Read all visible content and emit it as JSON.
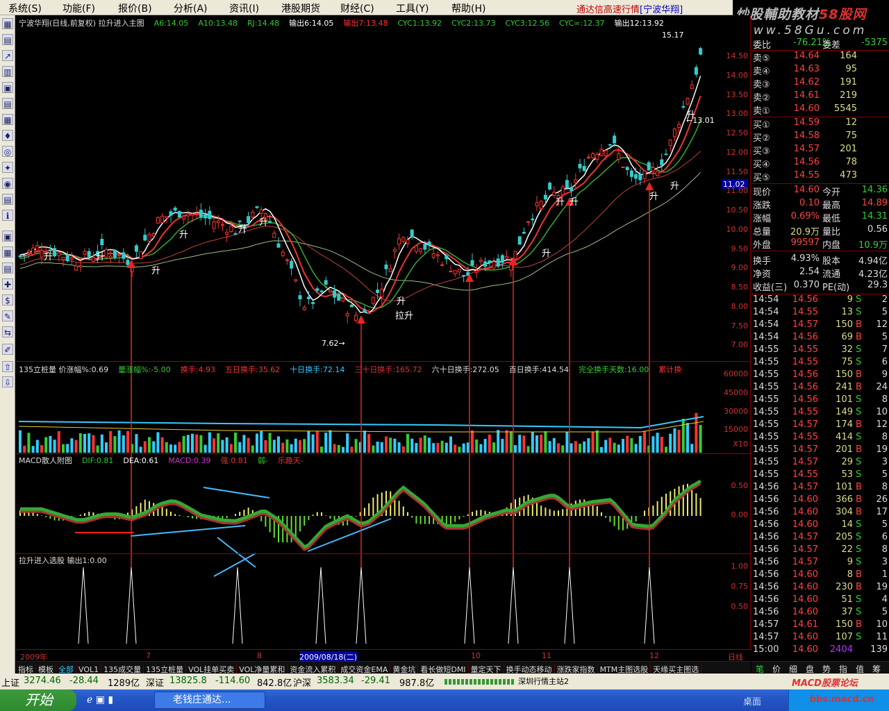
{
  "menu": [
    "系统(S)",
    "功能(F)",
    "报价(B)",
    "分析(A)",
    "资讯(I)",
    "港股期货",
    "财经(C)",
    "工具(Y)",
    "帮助(H)"
  ],
  "app_title": "通达信高速行情",
  "stock_bracket": "[宁波华翔]",
  "watermark": {
    "line1": "炒股輔助教材",
    "line1_red": "58股网",
    "line2": "www.58Gu.com"
  },
  "price_header": [
    {
      "t": "宁波华翔(日线,前复权) 拉升进入主图",
      "c": "#ddd"
    },
    {
      "t": "A6:14.05",
      "c": "#3c3"
    },
    {
      "t": "A10:13.48",
      "c": "#3c3"
    },
    {
      "t": "RJ:14.48",
      "c": "#3c3"
    },
    {
      "t": "输出6:14.05",
      "c": "#fff"
    },
    {
      "t": "输出7:13.48",
      "c": "#f33"
    },
    {
      "t": "CYC1:13.92",
      "c": "#3c3"
    },
    {
      "t": "CYC2:13.73",
      "c": "#3c3"
    },
    {
      "t": "CYC3:12.56",
      "c": "#3c3"
    },
    {
      "t": "CYC∞:12.37",
      "c": "#3c3"
    },
    {
      "t": "输出12:13.92",
      "c": "#fff"
    }
  ],
  "price_axis": [
    "14.50",
    "14.00",
    "13.50",
    "13.00",
    "12.50",
    "12.00",
    "11.50",
    "11.00",
    "10.50",
    "10.00",
    "9.50",
    "9.00",
    "8.50",
    "8.00",
    "7.50",
    "7.00"
  ],
  "price_marks": {
    "high": "15.17",
    "mid": "13.01",
    "low": "7.62",
    "current": "11.02"
  },
  "chart_labels": {
    "rise": "升",
    "lift": "拉升"
  },
  "vol_header": [
    {
      "t": "135立桩量 价涨幅%:0.69",
      "c": "#ddd"
    },
    {
      "t": "量涨幅%:-5.00",
      "c": "#3c3"
    },
    {
      "t": "换手:4.93",
      "c": "#f33"
    },
    {
      "t": "五日换手:35.62",
      "c": "#f33"
    },
    {
      "t": "十日换手:72.14",
      "c": "#3cf"
    },
    {
      "t": "三十日换手:165.72",
      "c": "#d33"
    },
    {
      "t": "六十日换手:272.05",
      "c": "#ddd"
    },
    {
      "t": "百日换手:414.54",
      "c": "#ddd"
    },
    {
      "t": "完全换手天数:16.00",
      "c": "#3c3"
    },
    {
      "t": "累计换",
      "c": "#f33"
    }
  ],
  "vol_axis": [
    "60000",
    "45000",
    "30000",
    "15000",
    "X10"
  ],
  "macd_header": [
    {
      "t": "MACD散人附图",
      "c": "#ddd"
    },
    {
      "t": "DIF:0.81",
      "c": "#3c3"
    },
    {
      "t": "DEA:0.61",
      "c": "#fff"
    },
    {
      "t": "MACD:0.39",
      "c": "#c3c"
    },
    {
      "t": "强:0.81",
      "c": "#d33"
    },
    {
      "t": "弱-",
      "c": "#3c3"
    },
    {
      "t": "乐趣天-",
      "c": "#d33"
    }
  ],
  "macd_axis": [
    "0.50",
    "0.00"
  ],
  "signal_header": "拉升进入选股 输出1:0.00",
  "signal_axis": [
    "1.00",
    "0.75",
    "0.50"
  ],
  "date_axis": [
    "2009年",
    "7",
    "8",
    "2009/08/18(二)",
    "10",
    "11",
    "12",
    "日线"
  ],
  "tabs": [
    "指标",
    "模板",
    "全部",
    "VOL1",
    "135成交量",
    "135立桩量",
    "VOL挂单买卖",
    "VOL净量累和",
    "资金流入累积",
    "成交资金EMA",
    "黄金坑",
    "看长做短DMI",
    "量定天下",
    "换手动态移动",
    "涨跌家指数",
    "MTM主图选股",
    "天缘买主图选"
  ],
  "active_tab": "全部",
  "quote": {
    "wei_bi": {
      "label": "委比",
      "value": "-76.21%",
      "label2": "委差",
      "value2": "-5375"
    },
    "sell": [
      {
        "l": "卖⑤",
        "p": "14.64",
        "v": "164"
      },
      {
        "l": "卖④",
        "p": "14.63",
        "v": "95"
      },
      {
        "l": "卖③",
        "p": "14.62",
        "v": "191"
      },
      {
        "l": "卖②",
        "p": "14.61",
        "v": "219"
      },
      {
        "l": "卖①",
        "p": "14.60",
        "v": "5545"
      }
    ],
    "buy": [
      {
        "l": "买①",
        "p": "14.59",
        "v": "12"
      },
      {
        "l": "买②",
        "p": "14.58",
        "v": "75"
      },
      {
        "l": "买③",
        "p": "14.57",
        "v": "201"
      },
      {
        "l": "买④",
        "p": "14.56",
        "v": "78"
      },
      {
        "l": "买⑤",
        "p": "14.55",
        "v": "473"
      }
    ],
    "stats": [
      {
        "l1": "现价",
        "v1": "14.60",
        "c1": "r",
        "l2": "今开",
        "v2": "14.36",
        "c2": "g"
      },
      {
        "l1": "涨跌",
        "v1": "0.10",
        "c1": "r",
        "l2": "最高",
        "v2": "14.89",
        "c2": "r"
      },
      {
        "l1": "涨幅",
        "v1": "0.69%",
        "c1": "r",
        "l2": "最低",
        "v2": "14.31",
        "c2": "g"
      },
      {
        "l1": "总量",
        "v1": "20.9万",
        "c1": "y",
        "l2": "量比",
        "v2": "0.56",
        "c2": "w"
      },
      {
        "l1": "外盘",
        "v1": "99597",
        "c1": "r",
        "l2": "内盘",
        "v2": "10.9万",
        "c2": "g"
      },
      {
        "l1": "换手",
        "v1": "4.93%",
        "c1": "w",
        "l2": "股本",
        "v2": "4.94亿",
        "c2": "w"
      },
      {
        "l1": "净资",
        "v1": "2.54",
        "c1": "w",
        "l2": "流通",
        "v2": "4.23亿",
        "c2": "w"
      },
      {
        "l1": "收益(三)",
        "v1": "0.370",
        "c1": "w",
        "l2": "PE(动)",
        "v2": "29.3",
        "c2": "w"
      }
    ]
  },
  "ticks": [
    [
      "14:54",
      "14.56",
      "9",
      "S",
      "2"
    ],
    [
      "14:54",
      "14.55",
      "13",
      "S",
      "5"
    ],
    [
      "14:54",
      "14.57",
      "150",
      "B",
      "12"
    ],
    [
      "14:54",
      "14.56",
      "69",
      "B",
      "5"
    ],
    [
      "14:55",
      "14.55",
      "32",
      "S",
      "7"
    ],
    [
      "14:55",
      "14.55",
      "75",
      "S",
      "6"
    ],
    [
      "14:55",
      "14.56",
      "150",
      "B",
      "9"
    ],
    [
      "14:55",
      "14.56",
      "241",
      "B",
      "24"
    ],
    [
      "14:55",
      "14.56",
      "101",
      "S",
      "8"
    ],
    [
      "14:55",
      "14.55",
      "149",
      "S",
      "10"
    ],
    [
      "14:55",
      "14.57",
      "174",
      "B",
      "12"
    ],
    [
      "14:55",
      "14.55",
      "414",
      "S",
      "8"
    ],
    [
      "14:55",
      "14.57",
      "201",
      "B",
      "19"
    ],
    [
      "14:55",
      "14.57",
      "29",
      "S",
      "3"
    ],
    [
      "14:55",
      "14.55",
      "53",
      "S",
      "5"
    ],
    [
      "14:56",
      "14.57",
      "101",
      "B",
      "8"
    ],
    [
      "14:56",
      "14.60",
      "366",
      "B",
      "26"
    ],
    [
      "14:56",
      "14.60",
      "304",
      "B",
      "17"
    ],
    [
      "14:56",
      "14.60",
      "14",
      "S",
      "5"
    ],
    [
      "14:56",
      "14.57",
      "205",
      "S",
      "6"
    ],
    [
      "14:56",
      "14.57",
      "22",
      "S",
      "8"
    ],
    [
      "14:56",
      "14.57",
      "9",
      "S",
      "3"
    ],
    [
      "14:56",
      "14.60",
      "8",
      "B",
      "1"
    ],
    [
      "14:56",
      "14.60",
      "230",
      "B",
      "19"
    ],
    [
      "14:56",
      "14.60",
      "51",
      "S",
      "4"
    ],
    [
      "14:56",
      "14.60",
      "37",
      "S",
      "5"
    ],
    [
      "14:57",
      "14.61",
      "150",
      "B",
      "10"
    ],
    [
      "14:57",
      "14.60",
      "107",
      "S",
      "11"
    ],
    [
      "15:00",
      "14.60",
      "2404",
      "",
      "139"
    ]
  ],
  "right_tabs": [
    "笔",
    "价",
    "细",
    "盘",
    "势",
    "指",
    "值",
    "筹"
  ],
  "status": {
    "sh_label": "上证",
    "sh": "3274.46",
    "sh_chg": "-28.44",
    "sh_amt": "1289亿",
    "sz_label": "深证",
    "sz": "13825.8",
    "sz_chg": "-114.60",
    "sz_amt": "842.8亿",
    "hs_label": "沪深",
    "hs": "3583.34",
    "hs_chg": "-29.41",
    "hs_amt": "987.8亿",
    "server": "深圳行情主站2",
    "forum": "MACD股票论坛"
  },
  "taskbar": {
    "start": "开始",
    "item": "老钱庄通达...",
    "desktop": "桌面",
    "tray_url": "bbs.macd.cn"
  }
}
